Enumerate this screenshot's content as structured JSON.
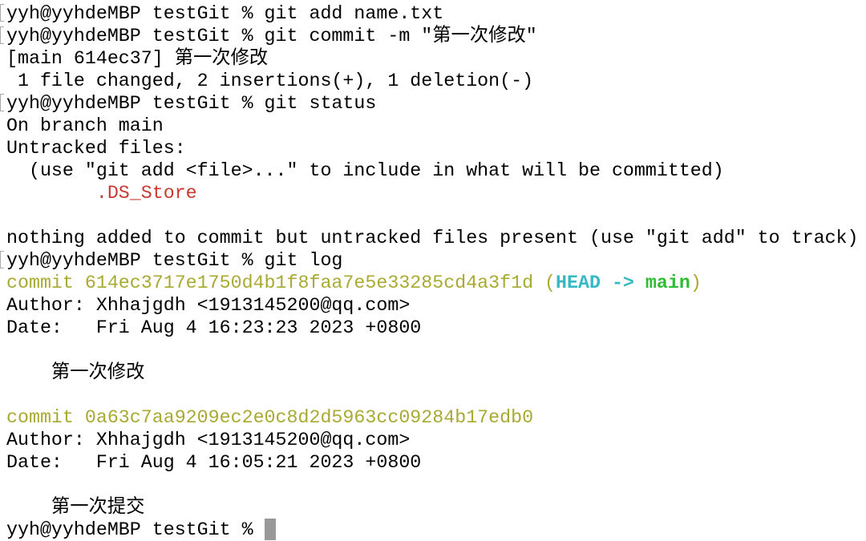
{
  "terminal": {
    "colors": {
      "yellow": "#a9a933",
      "cyan": "#36b9c4",
      "green": "#2fbc32",
      "red": "#c73a2f",
      "cursor": "#999999"
    },
    "lines": [
      {
        "mark": true,
        "segs": [
          {
            "t": "yyh@yyhdeMBP testGit % git add name.txt"
          }
        ]
      },
      {
        "mark": true,
        "segs": [
          {
            "t": "yyh@yyhdeMBP testGit % git commit -m \"第一次修改\""
          }
        ]
      },
      {
        "segs": [
          {
            "t": "[main 614ec37] 第一次修改"
          }
        ]
      },
      {
        "segs": [
          {
            "t": " 1 file changed, 2 insertions(+), 1 deletion(-)"
          }
        ]
      },
      {
        "mark": true,
        "segs": [
          {
            "t": "yyh@yyhdeMBP testGit % git status"
          }
        ]
      },
      {
        "segs": [
          {
            "t": "On branch main"
          }
        ]
      },
      {
        "segs": [
          {
            "t": "Untracked files:"
          }
        ]
      },
      {
        "segs": [
          {
            "t": "  (use \"git add <file>...\" to include in what will be committed)"
          }
        ]
      },
      {
        "segs": [
          {
            "t": "        "
          },
          {
            "t": ".DS_Store",
            "c": "red"
          }
        ]
      },
      {
        "segs": [
          {
            "t": ""
          }
        ]
      },
      {
        "segs": [
          {
            "t": "nothing added to commit but untracked files present (use \"git add\" to track)"
          }
        ]
      },
      {
        "mark": true,
        "segs": [
          {
            "t": "yyh@yyhdeMBP testGit % git log"
          }
        ]
      },
      {
        "segs": [
          {
            "t": "commit 614ec3717e1750d4b1f8faa7e5e33285cd4a3f1d (",
            "c": "yellow"
          },
          {
            "t": "HEAD -> ",
            "c": "cyan"
          },
          {
            "t": "main",
            "c": "green"
          },
          {
            "t": ")",
            "c": "yellow"
          }
        ]
      },
      {
        "segs": [
          {
            "t": "Author: Xhhajgdh <1913145200@qq.com>"
          }
        ]
      },
      {
        "segs": [
          {
            "t": "Date:   Fri Aug 4 16:23:23 2023 +0800"
          }
        ]
      },
      {
        "segs": [
          {
            "t": ""
          }
        ]
      },
      {
        "segs": [
          {
            "t": "    第一次修改"
          }
        ]
      },
      {
        "segs": [
          {
            "t": ""
          }
        ]
      },
      {
        "segs": [
          {
            "t": "commit 0a63c7aa9209ec2e0c8d2d5963cc09284b17edb0",
            "c": "yellow"
          }
        ]
      },
      {
        "segs": [
          {
            "t": "Author: Xhhajgdh <1913145200@qq.com>"
          }
        ]
      },
      {
        "segs": [
          {
            "t": "Date:   Fri Aug 4 16:05:21 2023 +0800"
          }
        ]
      },
      {
        "segs": [
          {
            "t": ""
          }
        ]
      },
      {
        "segs": [
          {
            "t": "    第一次提交"
          }
        ]
      },
      {
        "cursor": true,
        "segs": [
          {
            "t": "yyh@yyhdeMBP testGit % "
          }
        ]
      }
    ]
  }
}
